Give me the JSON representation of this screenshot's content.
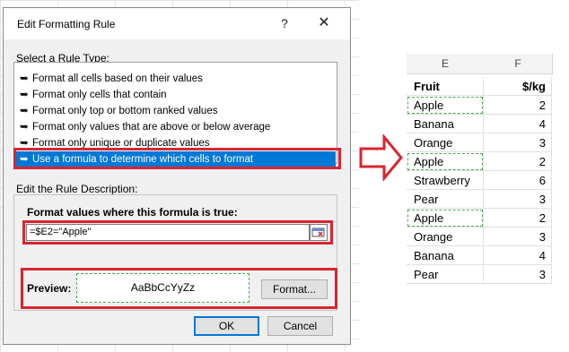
{
  "dialog": {
    "title": "Edit Formatting Rule",
    "help_label": "?",
    "close_label": "✕",
    "select_rule_type_label": "Select a Rule Type:",
    "rule_types": [
      {
        "label": "Format all cells based on their values",
        "selected": false
      },
      {
        "label": "Format only cells that contain",
        "selected": false
      },
      {
        "label": "Format only top or bottom ranked values",
        "selected": false
      },
      {
        "label": "Format only values that are above or below average",
        "selected": false
      },
      {
        "label": "Format only unique or duplicate values",
        "selected": false
      },
      {
        "label": "Use a formula to determine which cells to format",
        "selected": true
      }
    ],
    "edit_description_label": "Edit the Rule Description:",
    "formula_label": "Format values where this formula is true:",
    "formula_value": "=$E2=\"Apple\"",
    "preview_label": "Preview:",
    "preview_text": "AaBbCcYyZz",
    "format_button": "Format...",
    "ok_button": "OK",
    "cancel_button": "Cancel"
  },
  "sheet": {
    "columns": [
      "E",
      "F"
    ],
    "header": [
      "Fruit",
      "$/kg"
    ],
    "rows": [
      {
        "fruit": "Apple",
        "price": "2",
        "highlight": true
      },
      {
        "fruit": "Banana",
        "price": "4",
        "highlight": false
      },
      {
        "fruit": "Orange",
        "price": "3",
        "highlight": false
      },
      {
        "fruit": "Apple",
        "price": "2",
        "highlight": true
      },
      {
        "fruit": "Strawberry",
        "price": "6",
        "highlight": false
      },
      {
        "fruit": "Pear",
        "price": "3",
        "highlight": false
      },
      {
        "fruit": "Apple",
        "price": "2",
        "highlight": true
      },
      {
        "fruit": "Orange",
        "price": "3",
        "highlight": false
      },
      {
        "fruit": "Banana",
        "price": "4",
        "highlight": false
      },
      {
        "fruit": "Pear",
        "price": "3",
        "highlight": false
      }
    ]
  },
  "colors": {
    "highlight_red": "#d9252f",
    "selection_blue": "#0078d7",
    "preview_green": "#4caa4c"
  }
}
